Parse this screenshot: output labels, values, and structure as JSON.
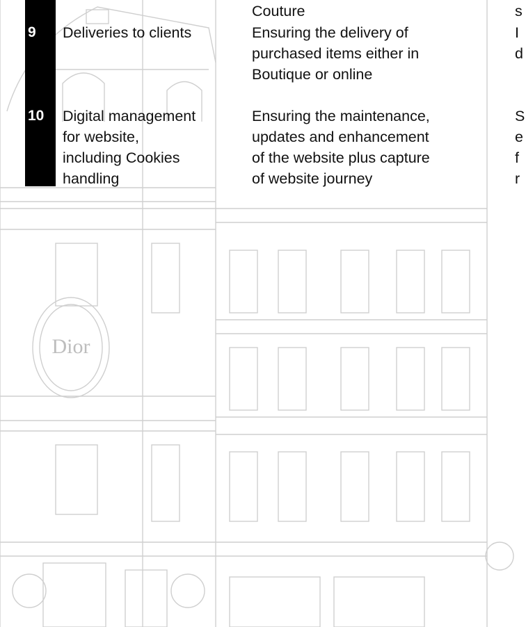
{
  "table": {
    "top_cont": {
      "purpose": "Couture",
      "detail": "s"
    },
    "rows": [
      {
        "num": "9",
        "activity": [
          "Deliveries to clients"
        ],
        "purpose": [
          "Ensuring the delivery of",
          "purchased items either in",
          "Boutique or online"
        ],
        "detail": [
          "I",
          "d"
        ]
      },
      {
        "num": "10",
        "activity": [
          "Digital management",
          "for website,",
          "including Cookies",
          "handling"
        ],
        "purpose": [
          "Ensuring the maintenance,",
          "updates and enhancement",
          "of the website plus capture",
          "of website journey"
        ],
        "detail": [
          "S",
          "e",
          "f",
          "r"
        ]
      }
    ]
  },
  "background": {
    "logo_text": "Dior"
  }
}
